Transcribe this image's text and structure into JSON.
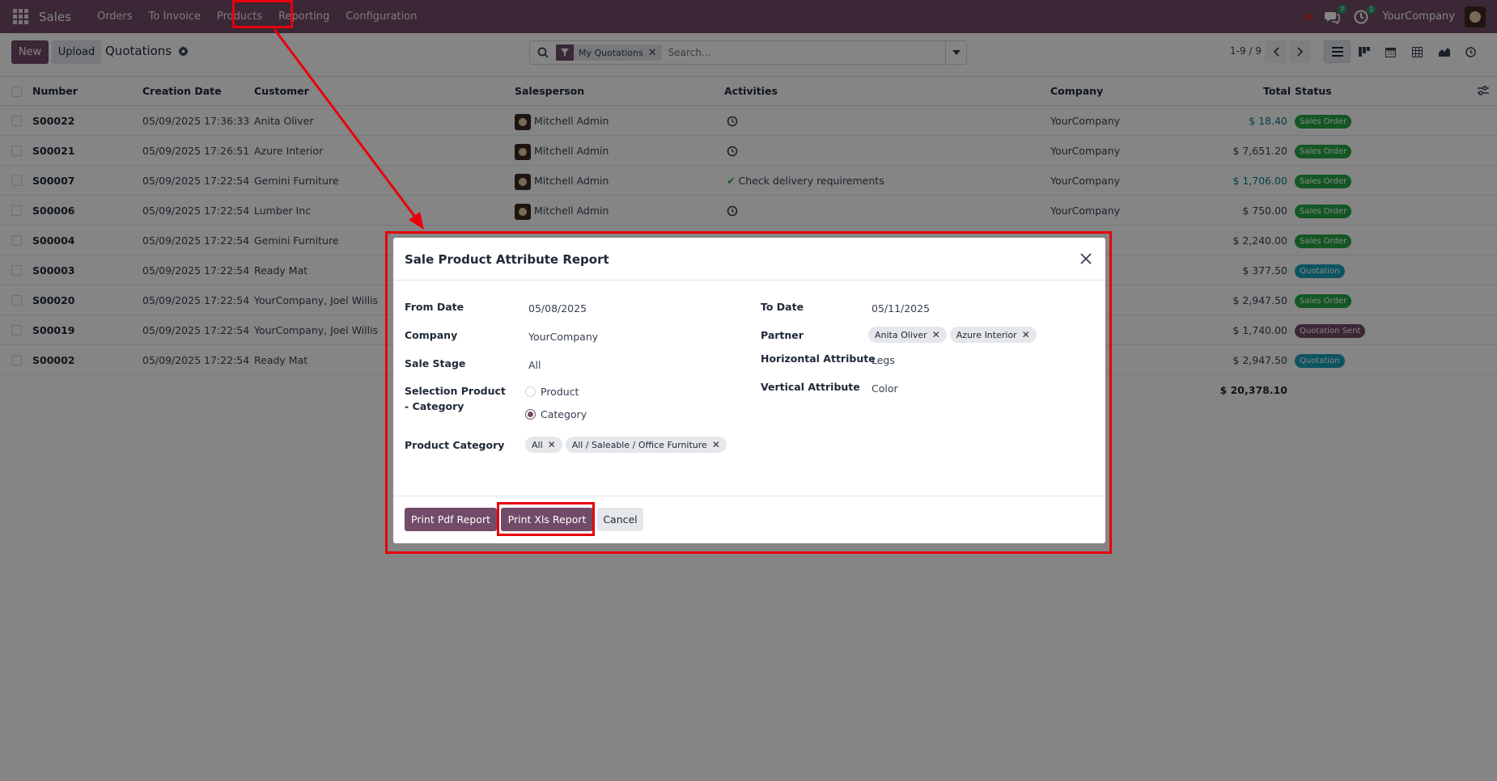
{
  "navbar": {
    "app_name": "Sales",
    "menu": [
      "Orders",
      "To Invoice",
      "Products",
      "Reporting",
      "Configuration"
    ],
    "messages_badge": "7",
    "activities_badge": "1",
    "company": "YourCompany"
  },
  "control": {
    "new_label": "New",
    "upload_label": "Upload",
    "breadcrumb": "Quotations",
    "facet_label": "My Quotations",
    "search_placeholder": "Search...",
    "pager": "1-9 / 9"
  },
  "table": {
    "headers": {
      "number": "Number",
      "creation_date": "Creation Date",
      "customer": "Customer",
      "salesperson": "Salesperson",
      "activities": "Activities",
      "company": "Company",
      "total": "Total",
      "status": "Status"
    },
    "rows": [
      {
        "number": "S00022",
        "date": "05/09/2025 17:36:33",
        "customer": "Anita Oliver",
        "salesperson": "Mitchell Admin",
        "activity": "",
        "company": "YourCompany",
        "total": "$ 18.40",
        "status": "Sales Order"
      },
      {
        "number": "S00021",
        "date": "05/09/2025 17:26:51",
        "customer": "Azure Interior",
        "salesperson": "Mitchell Admin",
        "activity": "",
        "company": "YourCompany",
        "total": "$ 7,651.20",
        "status": "Sales Order"
      },
      {
        "number": "S00007",
        "date": "05/09/2025 17:22:54",
        "customer": "Gemini Furniture",
        "salesperson": "Mitchell Admin",
        "activity": "Check delivery requirements",
        "company": "YourCompany",
        "total": "$ 1,706.00",
        "status": "Sales Order"
      },
      {
        "number": "S00006",
        "date": "05/09/2025 17:22:54",
        "customer": "Lumber Inc",
        "salesperson": "Mitchell Admin",
        "activity": "",
        "company": "YourCompany",
        "total": "$ 750.00",
        "status": "Sales Order"
      },
      {
        "number": "S00004",
        "date": "05/09/2025 17:22:54",
        "customer": "Gemini Furniture",
        "salesperson": "",
        "activity": "",
        "company": "",
        "total": "$ 2,240.00",
        "status": "Sales Order"
      },
      {
        "number": "S00003",
        "date": "05/09/2025 17:22:54",
        "customer": "Ready Mat",
        "salesperson": "",
        "activity": "",
        "company": "",
        "total": "$ 377.50",
        "status": "Quotation"
      },
      {
        "number": "S00020",
        "date": "05/09/2025 17:22:54",
        "customer": "YourCompany, Joel Willis",
        "salesperson": "",
        "activity": "",
        "company": "",
        "total": "$ 2,947.50",
        "status": "Sales Order"
      },
      {
        "number": "S00019",
        "date": "05/09/2025 17:22:54",
        "customer": "YourCompany, Joel Willis",
        "salesperson": "",
        "activity": "",
        "company": "",
        "total": "$ 1,740.00",
        "status": "Quotation Sent"
      },
      {
        "number": "S00002",
        "date": "05/09/2025 17:22:54",
        "customer": "Ready Mat",
        "salesperson": "",
        "activity": "",
        "company": "",
        "total": "$ 2,947.50",
        "status": "Quotation"
      }
    ],
    "sum_total": "$ 20,378.10"
  },
  "dialog": {
    "title": "Sale Product Attribute Report",
    "from_date_label": "From Date",
    "from_date": "05/08/2025",
    "to_date_label": "To Date",
    "to_date": "05/11/2025",
    "company_label": "Company",
    "company": "YourCompany",
    "partner_label": "Partner",
    "partners": [
      "Anita Oliver",
      "Azure Interior"
    ],
    "sale_stage_label": "Sale Stage",
    "sale_stage": "All",
    "horizontal_attr_label": "Horizontal Attribute",
    "horizontal_attr": "Legs",
    "vertical_attr_label": "Vertical Attribute",
    "vertical_attr": "Color",
    "selection_label": "Selection Product - Category",
    "option_product": "Product",
    "option_category": "Category",
    "product_category_label": "Product Category",
    "categories": [
      "All",
      "All / Saleable / Office Furniture"
    ],
    "btn_pdf": "Print Pdf Report",
    "btn_xls": "Print Xls Report",
    "btn_cancel": "Cancel"
  },
  "colors": {
    "brand": "#714B67",
    "annotation": "#e8000b",
    "success": "#28a745",
    "info": "#17a2b8"
  }
}
